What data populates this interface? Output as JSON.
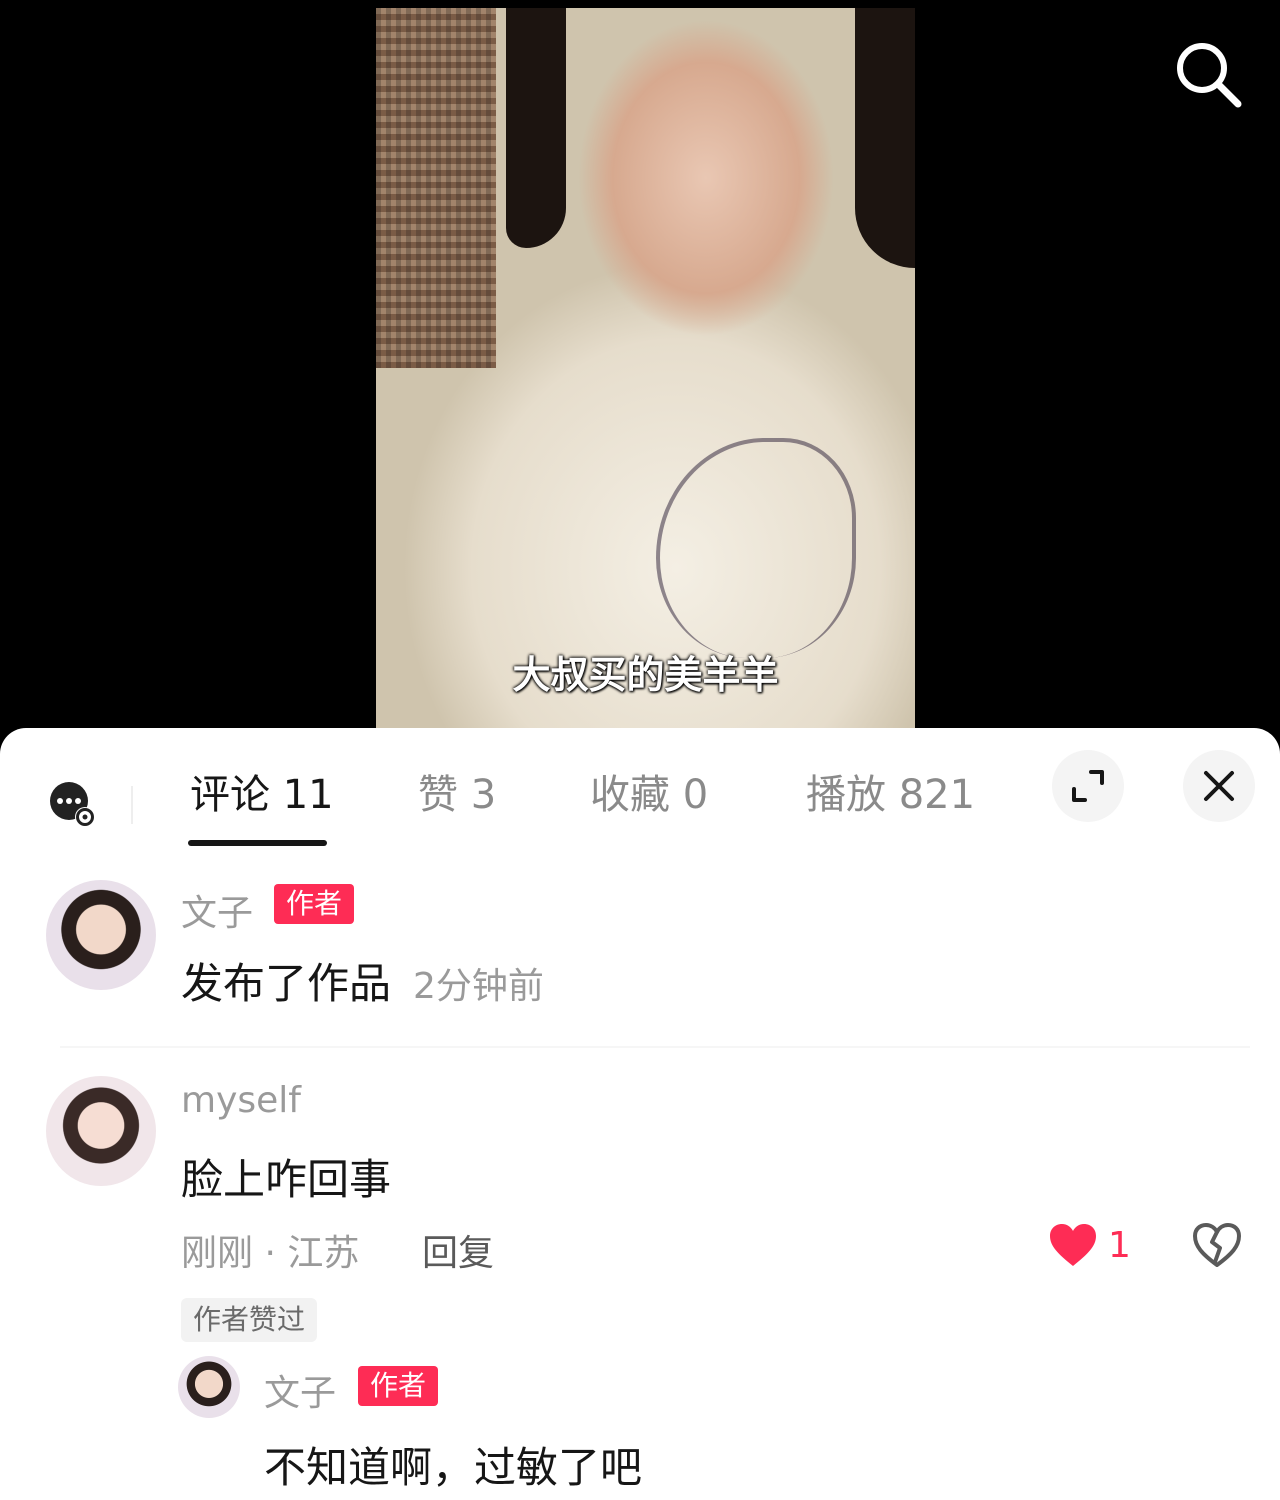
{
  "video": {
    "subtitle": "大叔买的美羊羊"
  },
  "tabs": [
    {
      "label": "评论 11",
      "active": true
    },
    {
      "label": "赞 3",
      "active": false
    },
    {
      "label": "收藏 0",
      "active": false
    },
    {
      "label": "播放 821",
      "active": false
    }
  ],
  "comments": [
    {
      "username": "文子",
      "tag": "作者",
      "text": "发布了作品",
      "time": "2分钟前"
    },
    {
      "username": "myself",
      "text": "脸上咋回事",
      "meta": "刚刚 · 江苏",
      "reply_label": "回复",
      "likes": "1",
      "liked_by_author": "作者赞过",
      "replies": [
        {
          "username": "文子",
          "tag": "作者",
          "text": "不知道啊，过敏了吧"
        }
      ]
    }
  ],
  "colors": {
    "accent": "#fe2c55",
    "text_primary": "#161616",
    "text_secondary": "#9a9a9a"
  },
  "icons": {
    "search": "search-icon",
    "chat_settings": "chat-settings-icon",
    "expand": "expand-icon",
    "close": "close-icon",
    "heart": "heart-icon",
    "broken_heart": "broken-heart-icon"
  }
}
